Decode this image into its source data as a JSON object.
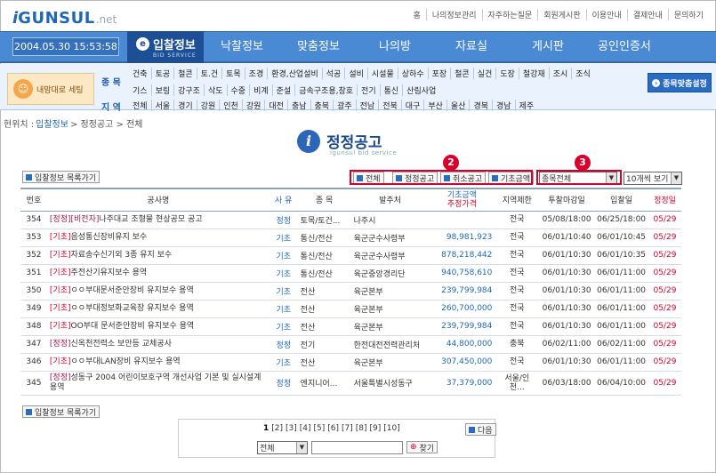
{
  "logo": {
    "i": "i",
    "brand": "GUNSUL",
    "suffix": ".net"
  },
  "top_links": [
    "홈",
    "나의정보관리",
    "자주하는질문",
    "회원게시판",
    "이용안내",
    "결제안내",
    "문의하기"
  ],
  "datetime": "2004.05.30 15:53:58",
  "nav": {
    "active": {
      "label": "입찰정보",
      "sub": "BID SERVICE",
      "icon": "e"
    },
    "items": [
      "낙찰정보",
      "맞춤정보",
      "나의방",
      "자료실",
      "게시판",
      "공인인증서"
    ]
  },
  "my_setting": "내맘대로 세팅",
  "category_labels": {
    "jongmok": "종 목",
    "jiyeok": "지 역"
  },
  "category_row1": [
    "건축",
    "토공",
    "철콘",
    "토.건",
    "토목",
    "조경",
    "환경,산업설비",
    "석공",
    "설비",
    "시설물",
    "상하수",
    "포장",
    "철콘",
    "실건",
    "도장",
    "철강재",
    "조시",
    "조식"
  ],
  "category_row2": [
    "기스",
    "보링",
    "강구조",
    "삭도",
    "수중",
    "비계",
    "준설",
    "금속구조용,창호",
    "전기",
    "통신",
    "산림사업"
  ],
  "region_row": [
    "전체",
    "서울",
    "경기",
    "강원",
    "인천",
    "강원",
    "대전",
    "충남",
    "충북",
    "광주",
    "전남",
    "전북",
    "대구",
    "부산",
    "울산",
    "경북",
    "경남",
    "제주"
  ],
  "jongmok_button": "종목맞춤설정",
  "breadcrumb": {
    "prefix": "현위치 :",
    "current": "입찰정보",
    "rest": "> 정정공고 > 전체"
  },
  "title": {
    "main": "정정공고",
    "sub": "igunsul bid service",
    "icon": "i"
  },
  "list_back": "입찰정보 목록가기",
  "filter_buttons": [
    "전체",
    "정정공고",
    "취소공고",
    "기초금액"
  ],
  "badge2": "2",
  "badge3": "3",
  "select_jongmok": "종목전체",
  "select_view": "10개씩 보기",
  "table": {
    "headers": [
      "번호",
      "공사명",
      "사 유",
      "종 목",
      "발주처",
      "기초금액",
      "추정가격",
      "지역제한",
      "투찰마감일",
      "입찰일",
      "정정일"
    ],
    "rows": [
      {
        "no": "354",
        "tag": "[정정][비전자]",
        "name": "나주대교 조형물 현상공모 공고",
        "reason": "정정",
        "kind": "토목/토건...",
        "org": "나주시",
        "amount": "",
        "region": "전국",
        "due": "05/08/18:00",
        "bid": "06/25/18:00",
        "fix": "05/29"
      },
      {
        "no": "353",
        "tag": "[기초]",
        "name": "음성통신장비유지 보수",
        "reason": "기초",
        "kind": "통신/전산",
        "org": "육군군수사령부",
        "amount": "98,981,923",
        "region": "전국",
        "due": "06/01/10:40",
        "bid": "06/01/10:45",
        "fix": "05/29"
      },
      {
        "no": "352",
        "tag": "[기초]",
        "name": "자료송수신기외 3종 유지 보수",
        "reason": "기초",
        "kind": "통신/전산",
        "org": "육군군수사령부",
        "amount": "878,218,442",
        "region": "전국",
        "due": "06/01/10:30",
        "bid": "06/01/10:35",
        "fix": "05/29"
      },
      {
        "no": "351",
        "tag": "[기초]",
        "name": "주전산기유지보수 용역",
        "reason": "기초",
        "kind": "통신/전산",
        "org": "육군중앙경리단",
        "amount": "940,758,610",
        "region": "전국",
        "due": "06/01/10:30",
        "bid": "06/01/11:00",
        "fix": "05/29"
      },
      {
        "no": "350",
        "tag": "[기초]",
        "name": "ㅇㅇ부대문서준안장비 유지보수 용역",
        "reason": "기초",
        "kind": "전산",
        "org": "육군본부",
        "amount": "239,799,984",
        "region": "전국",
        "due": "06/01/10:30",
        "bid": "06/01/11:00",
        "fix": "05/29"
      },
      {
        "no": "349",
        "tag": "[기초]",
        "name": "ㅇㅇ부대정보화교육장 유지보수 용역",
        "reason": "기초",
        "kind": "전산",
        "org": "육군본부",
        "amount": "260,700,000",
        "region": "전국",
        "due": "06/01/10:30",
        "bid": "06/01/11:00",
        "fix": "05/29"
      },
      {
        "no": "348",
        "tag": "[기초]",
        "name": "OO부대 문서준안장비 유지보수 용역",
        "reason": "기초",
        "kind": "전산",
        "org": "육군본부",
        "amount": "239,799,984",
        "region": "전국",
        "due": "06/01/10:30",
        "bid": "06/01/11:00",
        "fix": "05/29"
      },
      {
        "no": "347",
        "tag": "[정정]",
        "name": "신옥천전력소 보안등 교체공사",
        "reason": "정정",
        "kind": "전기",
        "org": "한전대전전력관리처",
        "amount": "44,800,000",
        "region": "충북",
        "due": "06/02/11:00",
        "bid": "06/02/11:00",
        "fix": "05/29"
      },
      {
        "no": "346",
        "tag": "[기초]",
        "name": "ㅇㅇ부대LAN장비 유지보수 용역",
        "reason": "기초",
        "kind": "전산",
        "org": "육군본부",
        "amount": "307,450,000",
        "region": "전국",
        "due": "06/01/10:30",
        "bid": "06/01/11:00",
        "fix": "05/29"
      },
      {
        "no": "345",
        "tag": "[정정]",
        "name": "성동구 2004 어린이보호구역 개선사업 기본 및 실시설계용역",
        "reason": "정정",
        "kind": "엔지니어...",
        "org": "서울특별시성동구",
        "amount": "37,379,000",
        "region": "서울/인천...",
        "due": "06/03/18:00",
        "bid": "06/04/10:00",
        "fix": "05/29"
      }
    ]
  },
  "pager": {
    "pages": [
      "1",
      "[2]",
      "[3]",
      "[4]",
      "[5]",
      "[6]",
      "[7]",
      "[8]",
      "[9]",
      "[10]"
    ],
    "next": "다음"
  },
  "search": {
    "select": "전체",
    "button": "찾기"
  }
}
